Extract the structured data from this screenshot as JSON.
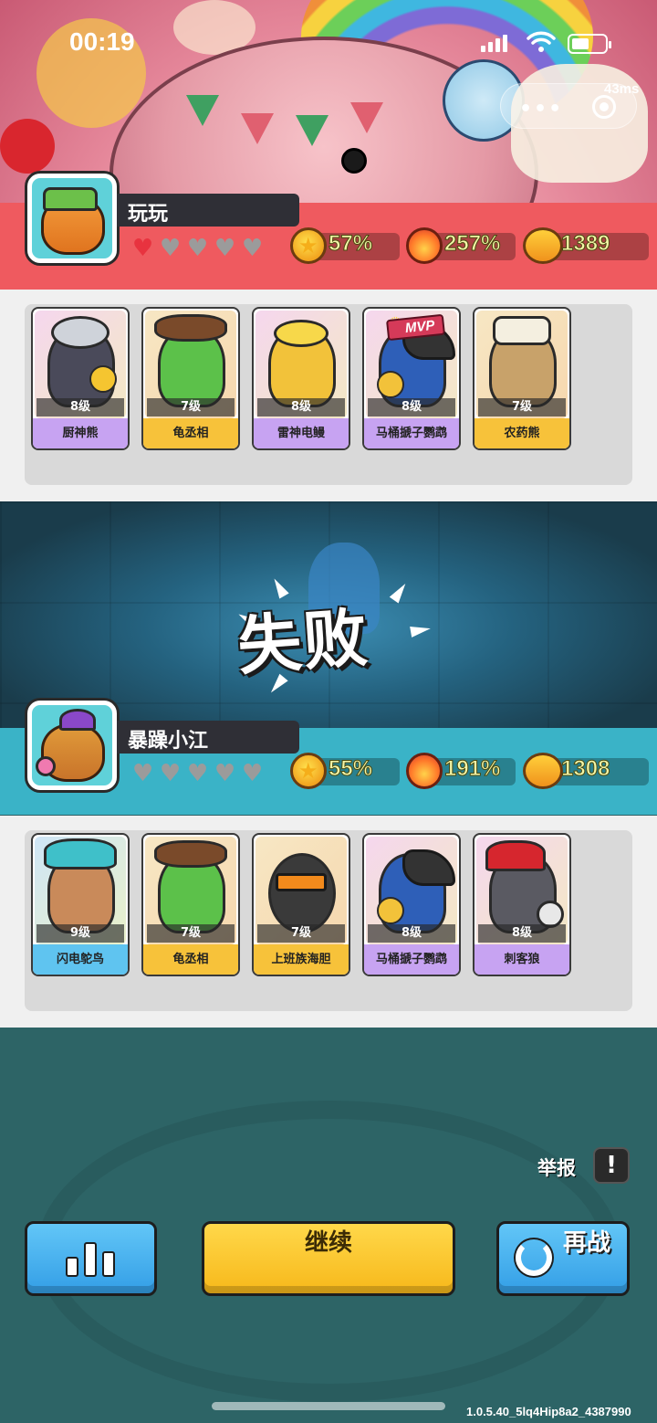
{
  "status_bar": {
    "time": "00:19",
    "ping": "43ms"
  },
  "players": [
    {
      "name": "玩玩",
      "hearts": {
        "filled": 1,
        "total": 5
      },
      "stats": {
        "win_rate": "57%",
        "damage": "257%",
        "trophies": "1389"
      },
      "heroes": [
        {
          "name": "厨神熊",
          "level": "8级",
          "rarity": "purple"
        },
        {
          "name": "龟丞相",
          "level": "7级",
          "rarity": "orange"
        },
        {
          "name": "雷神电鳗",
          "level": "8级",
          "rarity": "purple"
        },
        {
          "name": "马桶搋子鹦鹉",
          "level": "8级",
          "rarity": "purple",
          "badge": "MVP"
        },
        {
          "name": "农药熊",
          "level": "7级",
          "rarity": "orange"
        }
      ]
    },
    {
      "name": "暴躁小江",
      "hearts": {
        "filled": 0,
        "total": 5
      },
      "stats": {
        "win_rate": "55%",
        "damage": "191%",
        "trophies": "1308"
      },
      "heroes": [
        {
          "name": "闪电鸵鸟",
          "level": "9级",
          "rarity": "blue"
        },
        {
          "name": "龟丞相",
          "level": "7级",
          "rarity": "orange"
        },
        {
          "name": "上班族海胆",
          "level": "7级",
          "rarity": "orange"
        },
        {
          "name": "马桶搋子鹦鹉",
          "level": "8级",
          "rarity": "purple"
        },
        {
          "name": "刺客狼",
          "level": "8级",
          "rarity": "purple"
        }
      ]
    }
  ],
  "result": {
    "text": "失败"
  },
  "actions": {
    "report_label": "举报",
    "report_icon": "exclamation-icon",
    "stats_icon": "bar-chart-icon",
    "continue_label": "继续",
    "rematch_label": "再战",
    "rematch_icon": "refresh-icon"
  },
  "version": "1.0.5.40_5lq4Hip8a2_4387990",
  "colors": {
    "player1_bar": "#ef5a5f",
    "player2_bar": "#3ab3c7",
    "continue_button": "#f7b81a",
    "secondary_button": "#339ee6",
    "heart_filled": "#e8333f",
    "heart_empty": "#9b9b9b"
  }
}
